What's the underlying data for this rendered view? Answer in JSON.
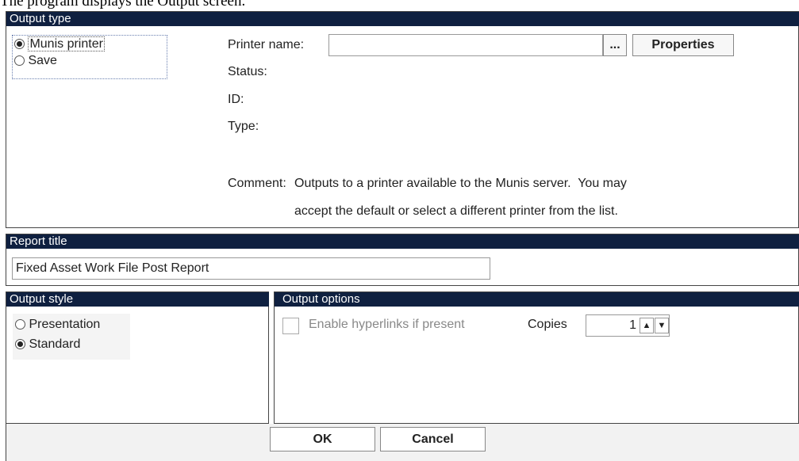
{
  "caption": "The program displays the Output screen.",
  "output_type": {
    "header": "Output type",
    "options": [
      {
        "label": "Munis printer",
        "selected": true
      },
      {
        "label": "Save",
        "selected": false
      }
    ],
    "printer_name_label": "Printer name:",
    "printer_name_value": "",
    "browse_label": "...",
    "properties_label": "Properties",
    "status_label": "Status:",
    "id_label": "ID:",
    "type_label": "Type:",
    "comment_label": "Comment:",
    "comment_line1": "Outputs to a printer available to the Munis server.  You may",
    "comment_line2": "accept the default or select a different printer from the list."
  },
  "report_title": {
    "header": "Report title",
    "value": "Fixed Asset Work File Post Report"
  },
  "output_style": {
    "header": "Output style",
    "options": [
      {
        "label": "Presentation",
        "selected": false
      },
      {
        "label": "Standard",
        "selected": true
      }
    ]
  },
  "output_options": {
    "header": "Output options",
    "hyperlinks_label": "Enable hyperlinks if present",
    "hyperlinks_checked": false,
    "copies_label": "Copies",
    "copies_value": "1",
    "up_icon": "up-arrow",
    "down_icon": "down-arrow"
  },
  "footer": {
    "ok_label": "OK",
    "cancel_label": "Cancel"
  }
}
